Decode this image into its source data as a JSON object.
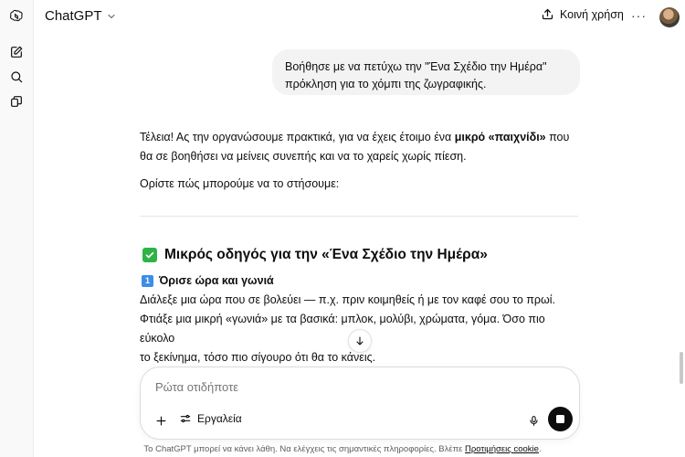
{
  "app": {
    "title": "ChatGPT",
    "colors": {
      "accent_check": "#2fb344",
      "keycap": "#3b8ee8",
      "bubble": "#f3f3f3",
      "stop": "#0d0d0d"
    }
  },
  "sidebar": {
    "icons": [
      "openai-logo-icon",
      "new-chat-icon",
      "search-icon",
      "library-icon"
    ]
  },
  "header": {
    "model_label": "ChatGPT",
    "share_label": "Κοινή χρήση",
    "more_label": "···"
  },
  "conversation": {
    "user_message": "Βοήθησε με να πετύχω την \"Ένα Σχέδιο την Ημέρα\" πρόκληση για το χόμπι της ζωγραφικής.",
    "assistant": {
      "intro_part1": "Τέλεια! Ας την οργανώσουμε πρακτικά, για να έχεις έτοιμο ένα ",
      "intro_bold": "μικρό «παιχνίδι»",
      "intro_part2": " που θα σε βοηθήσει να μείνεις συνεπής και να το χαρείς χωρίς πίεση.",
      "setup_line": "Ορίστε πώς μπορούμε να το στήσουμε:",
      "guide_heading": "Μικρός οδηγός για την «Ένα Σχέδιο την Ημέρα»",
      "step1_number": "1",
      "step1_heading": "Όρισε ώρα και γωνιά",
      "step1_line1": "Διάλεξε μια ώρα που σε βολεύει — π.χ. πριν κοιμηθείς ή με τον καφέ σου το πρωί.",
      "step1_line2": "Φτιάξε μια μικρή «γωνιά» με τα βασικά: μπλοκ, μολύβι, χρώματα, γόμα. Όσο πιο εύκολο",
      "step1_line3": "το ξεκίνημα, τόσο πιο σίγουρο ότι θα το κάνεις."
    }
  },
  "composer": {
    "placeholder": "Ρώτα οτιδήποτε",
    "tools_label": "Εργαλεία"
  },
  "footer": {
    "disclaimer": "Το ChatGPT μπορεί να κάνει λάθη. Να ελέγχεις τις σημαντικές πληροφορίες. Βλέπε ",
    "link_label": "Προτιμήσεις cookie",
    "suffix": "."
  }
}
